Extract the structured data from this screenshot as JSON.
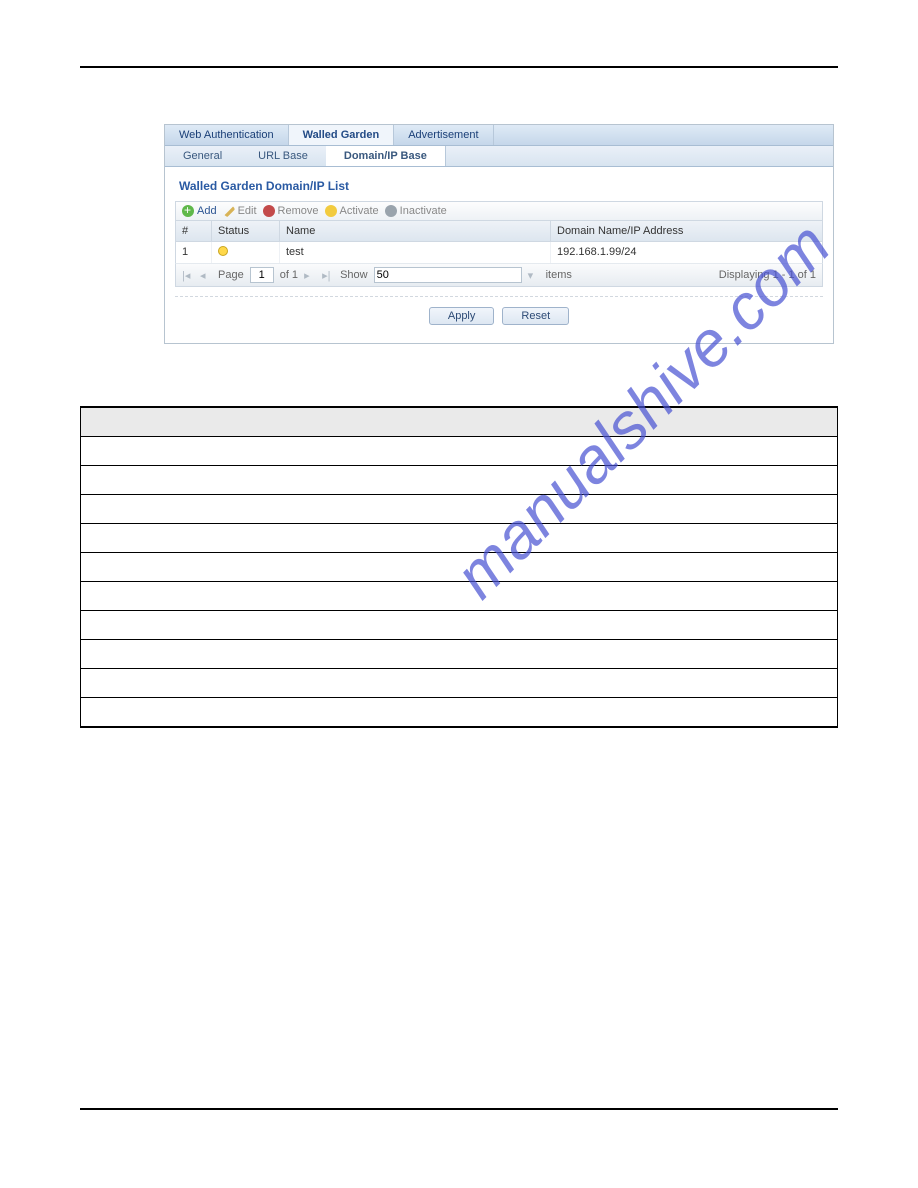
{
  "watermark": "manualshive.com",
  "tabs": {
    "primary": [
      "Web Authentication",
      "Walled Garden",
      "Advertisement"
    ],
    "secondary": [
      "General",
      "URL Base",
      "Domain/IP Base"
    ]
  },
  "panelTitle": "Walled Garden Domain/IP List",
  "toolbar": {
    "add": "Add",
    "edit": "Edit",
    "remove": "Remove",
    "activate": "Activate",
    "inactivate": "Inactivate"
  },
  "grid": {
    "headers": {
      "idx": "#",
      "status": "Status",
      "name": "Name",
      "domain": "Domain Name/IP Address"
    },
    "rows": [
      {
        "idx": "1",
        "name": "test",
        "domain": "192.168.1.99/24"
      }
    ]
  },
  "pager": {
    "pageLabel": "Page",
    "pageValue": "1",
    "ofLabel": "of 1",
    "showLabel": "Show",
    "showValue": "50",
    "itemsLabel": "items",
    "summary": "Displaying 1 - 1 of 1"
  },
  "buttons": {
    "apply": "Apply",
    "reset": "Reset"
  },
  "descTable": {
    "header": {
      "label": "",
      "description": ""
    },
    "rows": [
      {
        "label": "",
        "description": ""
      },
      {
        "label": "",
        "description": ""
      },
      {
        "label": "",
        "description": ""
      },
      {
        "label": "",
        "description": ""
      },
      {
        "label": "",
        "description": ""
      },
      {
        "label": "",
        "description": ""
      },
      {
        "label": "",
        "description": ""
      },
      {
        "label": "",
        "description": ""
      },
      {
        "label": "",
        "description": ""
      },
      {
        "label": "",
        "description": ""
      }
    ]
  }
}
